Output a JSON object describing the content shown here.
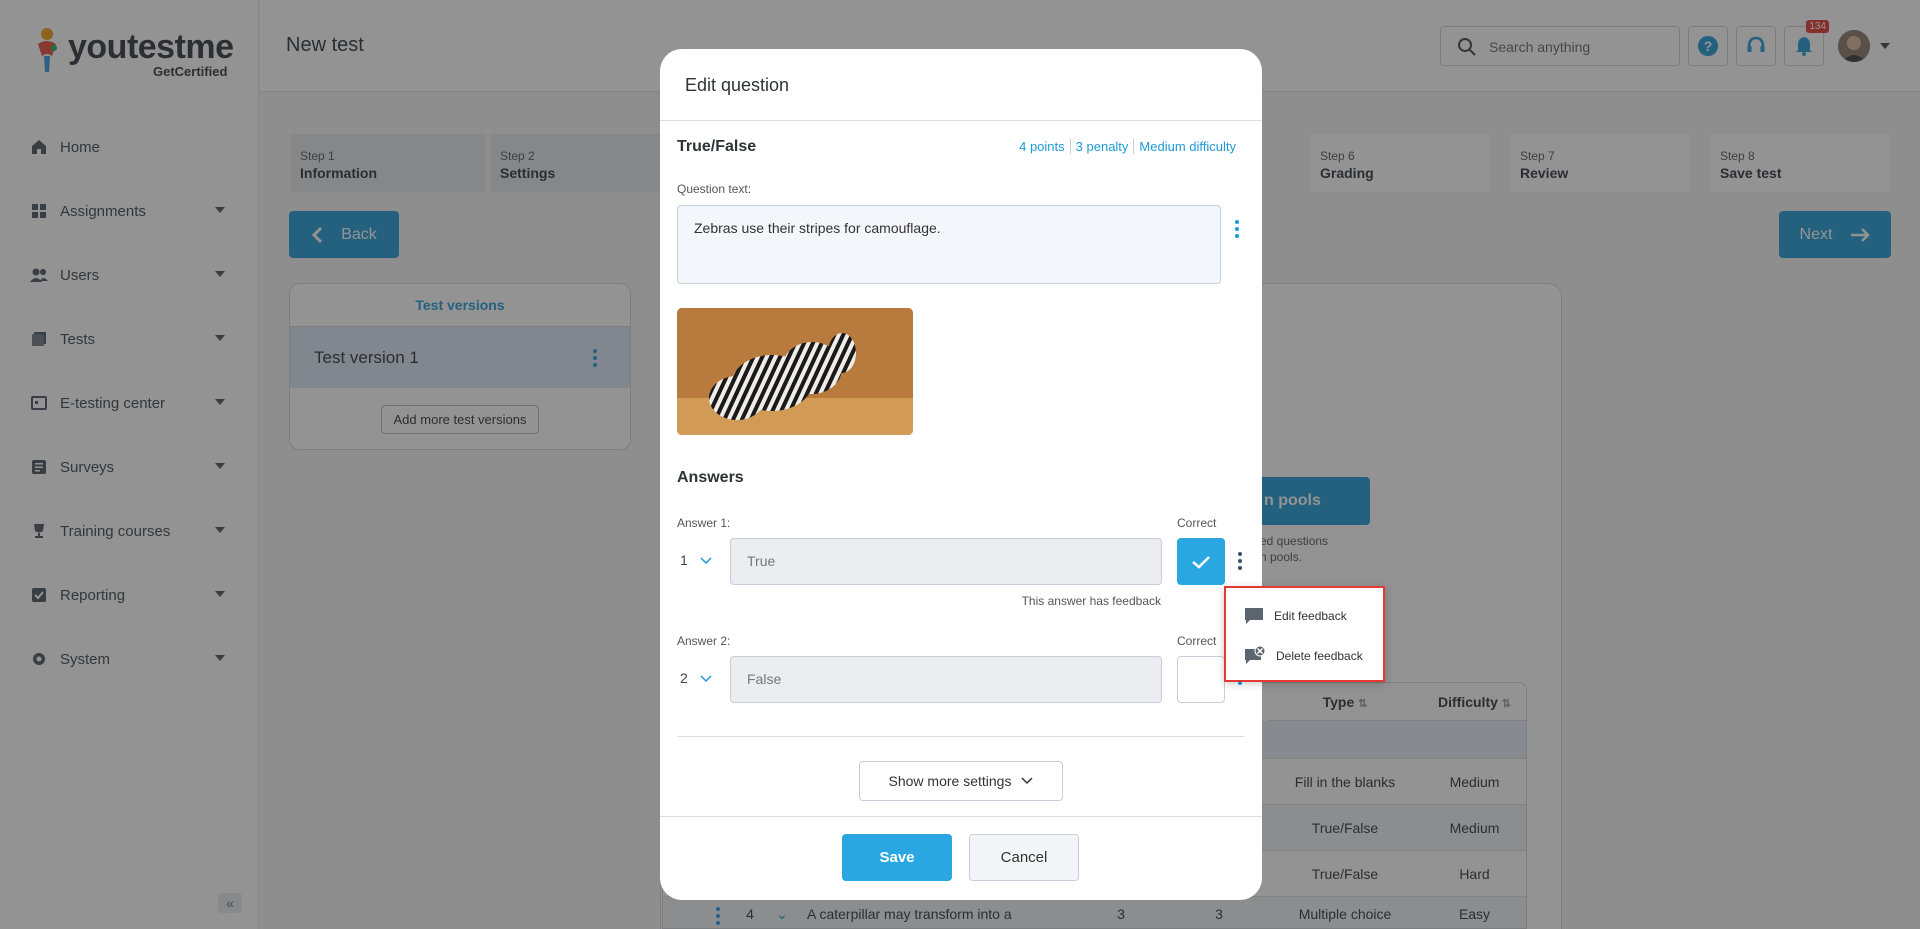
{
  "logo": {
    "text": "youtestme",
    "sub": "GetCertified"
  },
  "sidebar": {
    "items": [
      {
        "label": "Home",
        "icon": "home-icon",
        "has_caret": false
      },
      {
        "label": "Assignments",
        "icon": "assignments-icon",
        "has_caret": true
      },
      {
        "label": "Users",
        "icon": "users-icon",
        "has_caret": true
      },
      {
        "label": "Tests",
        "icon": "tests-icon",
        "has_caret": true
      },
      {
        "label": "E-testing center",
        "icon": "testing-center-icon",
        "has_caret": true
      },
      {
        "label": "Surveys",
        "icon": "surveys-icon",
        "has_caret": true
      },
      {
        "label": "Training courses",
        "icon": "trophy-icon",
        "has_caret": true
      },
      {
        "label": "Reporting",
        "icon": "reporting-icon",
        "has_caret": true
      },
      {
        "label": "System",
        "icon": "gear-icon",
        "has_caret": true
      }
    ],
    "collapse": "«"
  },
  "header": {
    "title": "New test",
    "search_placeholder": "Search anything",
    "notification_count": "134"
  },
  "steps": [
    {
      "num": "Step 1",
      "name": "Information"
    },
    {
      "num": "Step 2",
      "name": "Settings"
    },
    {
      "num": "Step 6",
      "name": "Grading"
    },
    {
      "num": "Step 7",
      "name": "Review"
    },
    {
      "num": "Step 8",
      "name": "Save test"
    }
  ],
  "nav": {
    "back": "Back",
    "next": "Next"
  },
  "versions": {
    "title": "Test versions",
    "item": "Test version 1",
    "add": "Add more test versions"
  },
  "pools": {
    "button": "n pools",
    "text1": "ed questions",
    "text2": "n pools."
  },
  "table": {
    "headers": {
      "type": "Type",
      "difficulty": "Difficulty"
    },
    "rows": [
      {
        "type": "Fill in the blanks",
        "difficulty": "Medium"
      },
      {
        "type": "True/False",
        "difficulty": "Medium"
      },
      {
        "type": "True/False",
        "difficulty": "Hard"
      }
    ],
    "last_row": {
      "num": "4",
      "text": "A caterpillar may transform into a ...",
      "c1": "3",
      "c2": "3",
      "type": "Multiple choice",
      "difficulty": "Easy"
    }
  },
  "modal": {
    "title": "Edit question",
    "type": "True/False",
    "meta": [
      "4 points",
      "3 penalty",
      "Medium difficulty"
    ],
    "question_label": "Question text:",
    "question_text": "Zebras use their stripes for camouflage.",
    "answers_title": "Answers",
    "correct_label": "Correct",
    "answers": [
      {
        "label": "Answer 1:",
        "num": "1",
        "value": "True",
        "correct": true
      },
      {
        "label": "Answer 2:",
        "num": "2",
        "value": "False",
        "correct": false
      }
    ],
    "feedback_note": "This answer has feedback",
    "show_more": "Show more settings",
    "save": "Save",
    "cancel": "Cancel"
  },
  "feedback_menu": {
    "edit": "Edit feedback",
    "delete": "Delete feedback"
  },
  "colors": {
    "accent": "#1e9bd7",
    "highlight": "#e53935"
  }
}
